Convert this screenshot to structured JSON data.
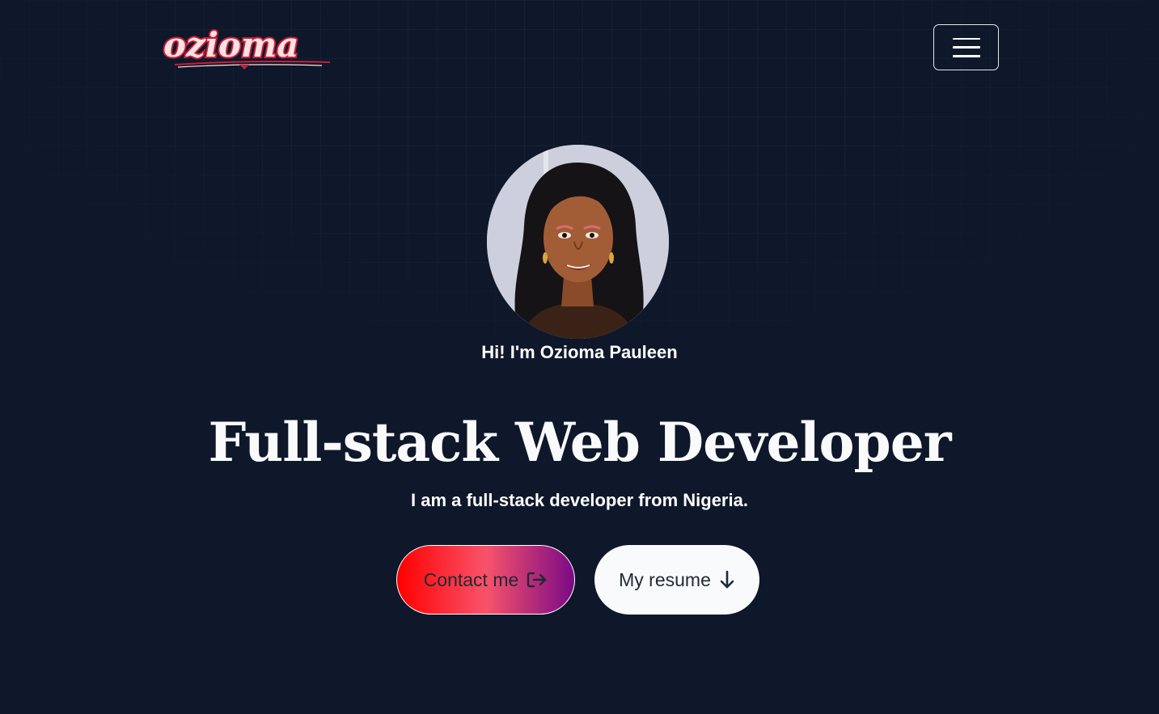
{
  "header": {
    "logo_text": "ozioma",
    "menu_icon": "hamburger-icon"
  },
  "hero": {
    "avatar_alt": "Ozioma Pauleen portrait",
    "greeting": "Hi! I'm Ozioma Pauleen",
    "headline": "Full-stack Web Developer",
    "subline": "I am a full-stack developer from Nigeria."
  },
  "actions": {
    "contact_label": "Contact me",
    "contact_icon": "sign-out-arrow-icon",
    "resume_label": "My resume",
    "resume_icon": "arrow-down-icon"
  },
  "colors": {
    "background": "#0f172a",
    "logo_fill": "#fde2e2",
    "logo_stroke": "#c81e3a",
    "contact_gradient_start": "#ff0000",
    "contact_gradient_mid": "#f8536a",
    "contact_gradient_end": "#7a0a86",
    "resume_bg": "#f8fafc"
  }
}
